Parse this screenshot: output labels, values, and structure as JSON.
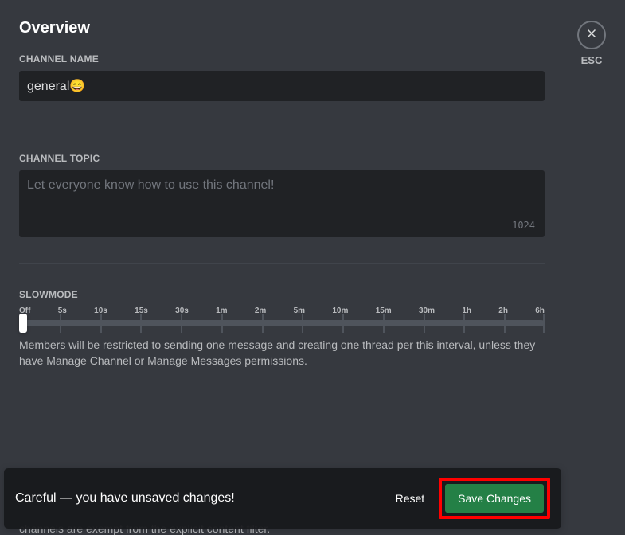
{
  "header": {
    "title": "Overview",
    "esc_label": "ESC"
  },
  "channel_name": {
    "label": "CHANNEL NAME",
    "value": "general😄"
  },
  "channel_topic": {
    "label": "CHANNEL TOPIC",
    "placeholder": "Let everyone know how to use this channel!",
    "value": "",
    "char_limit": "1024"
  },
  "slowmode": {
    "label": "SLOWMODE",
    "ticks": [
      "Off",
      "5s",
      "10s",
      "15s",
      "30s",
      "1m",
      "2m",
      "5m",
      "10m",
      "15m",
      "30m",
      "1h",
      "2h",
      "6h"
    ],
    "help": "Members will be restricted to sending one message and creating one thread per this interval, unless they have Manage Channel or Manage Messages permissions."
  },
  "hidden_section_text": "channels are exempt from the explicit content filter.",
  "toast": {
    "message": "Careful — you have unsaved changes!",
    "reset": "Reset",
    "save": "Save Changes"
  }
}
